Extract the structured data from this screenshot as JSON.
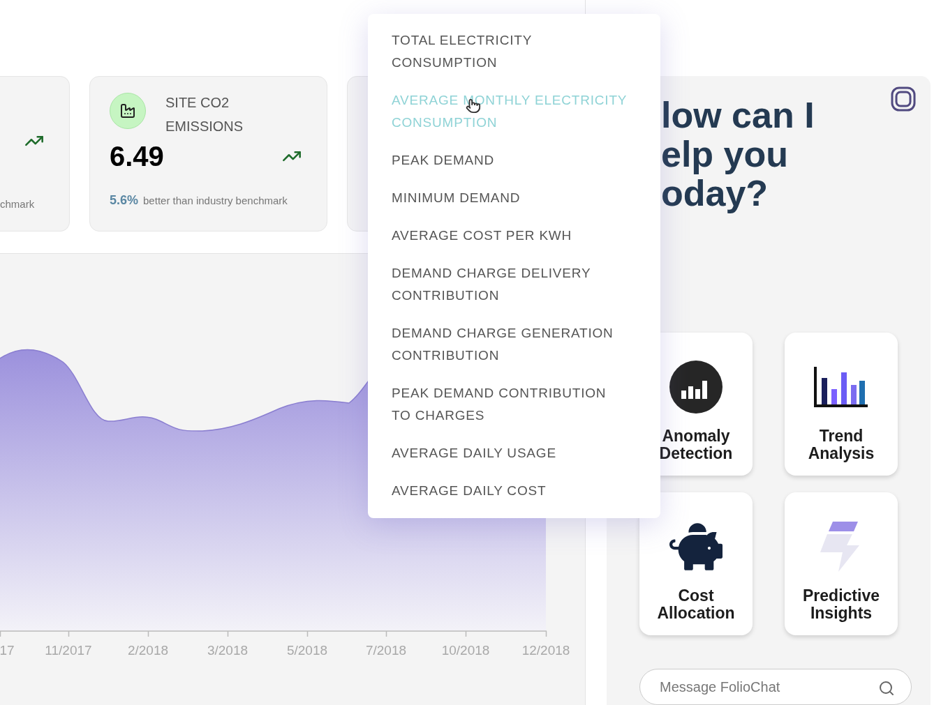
{
  "kpi_cards": [
    {
      "kind": "partial",
      "footnote": "chmark"
    },
    {
      "kind": "full",
      "title": "SITE CO2 EMISSIONS",
      "value": "6.49",
      "change": "5.6%",
      "footnote": "better than industry benchmark"
    }
  ],
  "chart": {
    "x_labels": [
      "17",
      "11/2017",
      "2/2018",
      "3/2018",
      "5/2018",
      "7/2018",
      "10/2018",
      "12/2018"
    ]
  },
  "metric_menu": {
    "items": [
      {
        "label": "TOTAL ELECTRICITY CONSUMPTION",
        "selected": false
      },
      {
        "label": "AVERAGE MONTHLY ELECTRICITY CONSUMPTION",
        "selected": true
      },
      {
        "label": "PEAK DEMAND",
        "selected": false
      },
      {
        "label": "MINIMUM DEMAND",
        "selected": false
      },
      {
        "label": "AVERAGE COST PER KWH",
        "selected": false
      },
      {
        "label": "DEMAND CHARGE DELIVERY CONTRIBUTION",
        "selected": false
      },
      {
        "label": "DEMAND CHARGE GENERATION CONTRIBUTION",
        "selected": false
      },
      {
        "label": "PEAK DEMAND CONTRIBUTION TO CHARGES",
        "selected": false
      },
      {
        "label": "AVERAGE DAILY USAGE",
        "selected": false
      },
      {
        "label": "AVERAGE DAILY COST",
        "selected": false
      }
    ]
  },
  "assistant": {
    "heading_lines": [
      "low can I",
      "elp you",
      "oday?"
    ],
    "actions": [
      {
        "kind": "anomaly",
        "label": "Anomaly Detection"
      },
      {
        "kind": "trend",
        "label": "Trend Analysis"
      },
      {
        "kind": "cost",
        "label": "Cost Allocation"
      },
      {
        "kind": "predictive",
        "label": "Predictive Insights"
      }
    ],
    "message_field": {
      "placeholder": "Message FolioChat"
    }
  }
}
